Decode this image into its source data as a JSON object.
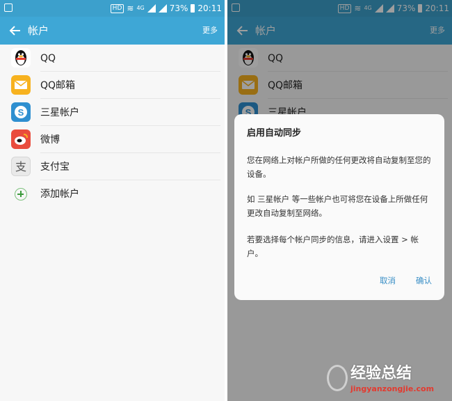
{
  "status_bar": {
    "hd": "HD",
    "network": "4G",
    "battery": "73%",
    "time": "20:11"
  },
  "app_bar": {
    "title": "帐户",
    "more": "更多"
  },
  "accounts": [
    {
      "label": "QQ",
      "icon": "qq-penguin-icon"
    },
    {
      "label": "QQ邮箱",
      "icon": "qq-mail-icon"
    },
    {
      "label": "三星帐户",
      "icon": "samsung-account-icon"
    },
    {
      "label": "微博",
      "icon": "weibo-icon"
    },
    {
      "label": "支付宝",
      "icon": "alipay-icon"
    },
    {
      "label": "添加帐户",
      "icon": "add-icon"
    }
  ],
  "dialog": {
    "title": "启用自动同步",
    "paragraph1": "您在网络上对帐户所做的任何更改将自动复制至您的设备。",
    "paragraph2": "如 三星帐户 等一些帐户也可将您在设备上所做任何更改自动复制至网络。",
    "paragraph3": "若要选择每个帐户同步的信息，请进入设置 > 帐户。",
    "cancel": "取消",
    "confirm": "确认"
  },
  "watermark": {
    "site": "经验总结",
    "url": "jingyanzongjie.com"
  },
  "colors": {
    "status_bar": "#3ca0cc",
    "app_bar": "#3ea7d6",
    "dialog_button": "#3a8fc6",
    "background": "#f7f7f7"
  }
}
